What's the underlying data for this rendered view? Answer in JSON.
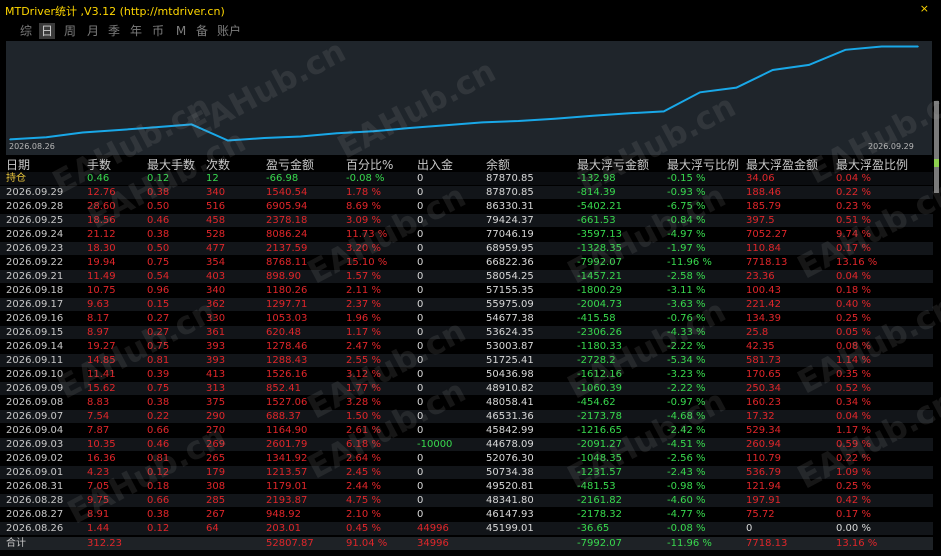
{
  "window": {
    "title": "MTDriver统计 ,V3.12 (http://mtdriver.cn)",
    "close_symbol": "×"
  },
  "tabs": [
    {
      "label": "综",
      "active": false
    },
    {
      "label": "日",
      "active": true
    },
    {
      "label": "周",
      "active": false
    },
    {
      "label": "月",
      "active": false
    },
    {
      "label": "季",
      "active": false
    },
    {
      "label": "年",
      "active": false
    },
    {
      "label": "币",
      "active": false
    },
    {
      "label": "M",
      "active": false
    },
    {
      "label": "备",
      "active": false
    },
    {
      "label": "账户",
      "active": false
    }
  ],
  "colors": {
    "line": "#19a8e8",
    "chart_bg": "#1f252b",
    "positive": "#e0262a",
    "negative": "#38d94e",
    "title": "#ffd700"
  },
  "chart_data": {
    "type": "line",
    "x_start_label": "2026.08.26",
    "x_end_label": "2026.09.29",
    "x": [
      "2026.08.26",
      "2026.08.27",
      "2026.08.28",
      "2026.08.31",
      "2026.09.01",
      "2026.09.02",
      "2026.09.03",
      "2026.09.04",
      "2026.09.07",
      "2026.09.08",
      "2026.09.09",
      "2026.09.10",
      "2026.09.11",
      "2026.09.14",
      "2026.09.15",
      "2026.09.16",
      "2026.09.17",
      "2026.09.18",
      "2026.09.21",
      "2026.09.22",
      "2026.09.23",
      "2026.09.24",
      "2026.09.25",
      "2026.09.28",
      "2026.09.29",
      "2026.09.29"
    ],
    "series": [
      {
        "values": [
          45199.01,
          46147.93,
          48341.8,
          49520.81,
          50734.38,
          52076.3,
          44678.09,
          45842.99,
          46531.36,
          48058.41,
          48910.82,
          50436.98,
          51725.41,
          53003.87,
          53624.35,
          54677.38,
          55975.09,
          57155.35,
          58054.25,
          66822.36,
          68959.95,
          77046.19,
          79424.37,
          86330.31,
          87870.85,
          87870.85
        ]
      }
    ],
    "grid": false,
    "ylim": [
      44000,
      89000
    ]
  },
  "table": {
    "headers": [
      "日期",
      "手数",
      "最大手数",
      "次数",
      "盈亏金额",
      "百分比%",
      "出入金",
      "余额",
      "最大浮亏金额",
      "最大浮亏比例",
      "最大浮盈金额",
      "最大浮盈比例"
    ],
    "position_row": [
      "持仓",
      "0.46",
      "0.12",
      "12",
      "-66.98",
      "-0.08 %",
      "0",
      "87870.85",
      "-132.98",
      "-0.15 %",
      "34.06",
      "0.04 %"
    ],
    "rows": [
      [
        "2026.09.29",
        "12.76",
        "0.38",
        "340",
        "1540.54",
        "1.78 %",
        "0",
        "87870.85",
        "-814.39",
        "-0.93 %",
        "188.46",
        "0.22 %"
      ],
      [
        "2026.09.28",
        "28.60",
        "0.50",
        "516",
        "6905.94",
        "8.69 %",
        "0",
        "86330.31",
        "-5402.21",
        "-6.75 %",
        "185.79",
        "0.23 %"
      ],
      [
        "2026.09.25",
        "18.56",
        "0.46",
        "458",
        "2378.18",
        "3.09 %",
        "0",
        "79424.37",
        "-661.53",
        "-0.84 %",
        "397.5",
        "0.51 %"
      ],
      [
        "2026.09.24",
        "21.12",
        "0.38",
        "528",
        "8086.24",
        "11.73 %",
        "0",
        "77046.19",
        "-3597.13",
        "-4.97 %",
        "7052.27",
        "9.74 %"
      ],
      [
        "2026.09.23",
        "18.30",
        "0.50",
        "477",
        "2137.59",
        "3.20 %",
        "0",
        "68959.95",
        "-1328.35",
        "-1.97 %",
        "110.84",
        "0.17 %"
      ],
      [
        "2026.09.22",
        "19.94",
        "0.75",
        "354",
        "8768.11",
        "15.10 %",
        "0",
        "66822.36",
        "-7992.07",
        "-11.96 %",
        "7718.13",
        "13.16 %"
      ],
      [
        "2026.09.21",
        "11.49",
        "0.54",
        "403",
        "898.90",
        "1.57 %",
        "0",
        "58054.25",
        "-1457.21",
        "-2.58 %",
        "23.36",
        "0.04 %"
      ],
      [
        "2026.09.18",
        "10.75",
        "0.96",
        "340",
        "1180.26",
        "2.11 %",
        "0",
        "57155.35",
        "-1800.29",
        "-3.11 %",
        "100.43",
        "0.18 %"
      ],
      [
        "2026.09.17",
        "9.63",
        "0.15",
        "362",
        "1297.71",
        "2.37 %",
        "0",
        "55975.09",
        "-2004.73",
        "-3.63 %",
        "221.42",
        "0.40 %"
      ],
      [
        "2026.09.16",
        "8.17",
        "0.27",
        "330",
        "1053.03",
        "1.96 %",
        "0",
        "54677.38",
        "-415.58",
        "-0.76 %",
        "134.39",
        "0.25 %"
      ],
      [
        "2026.09.15",
        "8.97",
        "0.27",
        "361",
        "620.48",
        "1.17 %",
        "0",
        "53624.35",
        "-2306.26",
        "-4.33 %",
        "25.8",
        "0.05 %"
      ],
      [
        "2026.09.14",
        "19.27",
        "0.75",
        "393",
        "1278.46",
        "2.47 %",
        "0",
        "53003.87",
        "-1180.33",
        "-2.22 %",
        "42.35",
        "0.08 %"
      ],
      [
        "2026.09.11",
        "14.85",
        "0.81",
        "393",
        "1288.43",
        "2.55 %",
        "0",
        "51725.41",
        "-2728.2",
        "-5.34 %",
        "581.73",
        "1.14 %"
      ],
      [
        "2026.09.10",
        "11.41",
        "0.39",
        "413",
        "1526.16",
        "3.12 %",
        "0",
        "50436.98",
        "-1612.16",
        "-3.23 %",
        "170.65",
        "0.35 %"
      ],
      [
        "2026.09.09",
        "15.62",
        "0.75",
        "313",
        "852.41",
        "1.77 %",
        "0",
        "48910.82",
        "-1060.39",
        "-2.22 %",
        "250.34",
        "0.52 %"
      ],
      [
        "2026.09.08",
        "8.83",
        "0.38",
        "375",
        "1527.06",
        "3.28 %",
        "0",
        "48058.41",
        "-454.62",
        "-0.97 %",
        "160.23",
        "0.34 %"
      ],
      [
        "2026.09.07",
        "7.54",
        "0.22",
        "290",
        "688.37",
        "1.50 %",
        "0",
        "46531.36",
        "-2173.78",
        "-4.68 %",
        "17.32",
        "0.04 %"
      ],
      [
        "2026.09.04",
        "7.87",
        "0.66",
        "270",
        "1164.90",
        "2.61 %",
        "0",
        "45842.99",
        "-1216.65",
        "-2.42 %",
        "529.34",
        "1.17 %"
      ],
      [
        "2026.09.03",
        "10.35",
        "0.46",
        "269",
        "2601.79",
        "6.18 %",
        "-10000",
        "44678.09",
        "-2091.27",
        "-4.51 %",
        "260.94",
        "0.59 %"
      ],
      [
        "2026.09.02",
        "16.36",
        "0.81",
        "265",
        "1341.92",
        "2.64 %",
        "0",
        "52076.30",
        "-1048.35",
        "-2.56 %",
        "110.79",
        "0.22 %"
      ],
      [
        "2026.09.01",
        "4.23",
        "0.12",
        "179",
        "1213.57",
        "2.45 %",
        "0",
        "50734.38",
        "-1231.57",
        "-2.43 %",
        "536.79",
        "1.09 %"
      ],
      [
        "2026.08.31",
        "7.05",
        "0.18",
        "308",
        "1179.01",
        "2.44 %",
        "0",
        "49520.81",
        "-481.53",
        "-0.98 %",
        "121.94",
        "0.25 %"
      ],
      [
        "2026.08.28",
        "9.75",
        "0.66",
        "285",
        "2193.87",
        "4.75 %",
        "0",
        "48341.80",
        "-2161.82",
        "-4.60 %",
        "197.91",
        "0.42 %"
      ],
      [
        "2026.08.27",
        "8.91",
        "0.38",
        "267",
        "948.92",
        "2.10 %",
        "0",
        "46147.93",
        "-2178.32",
        "-4.77 %",
        "75.72",
        "0.17 %"
      ],
      [
        "2026.08.26",
        "1.44",
        "0.12",
        "64",
        "203.01",
        "0.45 %",
        "44996",
        "45199.01",
        "-36.65",
        "-0.08 %",
        "0",
        "0.00 %"
      ]
    ],
    "total_row": [
      "合计",
      "312.23",
      "",
      "",
      "52807.87",
      "91.04 %",
      "34996",
      "",
      "-7992.07",
      "-11.96 %",
      "7718.13",
      "13.16 %"
    ]
  },
  "watermark": "EAHub.cn"
}
